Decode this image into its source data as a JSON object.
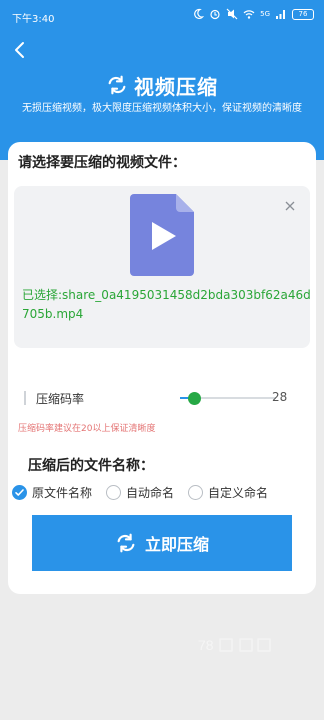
{
  "status_bar": {
    "time": "下午3:40",
    "battery": "76",
    "signal": "5G"
  },
  "header": {
    "title": "视频压缩",
    "subtitle": "无损压缩视频，极大限度压缩视频体积大小，保证视频的清晰度",
    "color": "#2a93e8"
  },
  "file_section": {
    "title": "请选择要压缩的视频文件：",
    "selected_prefix": "已选择:",
    "file_name": "share_0a4195031458d2bda303bf62a46d705b.mp4",
    "icon_color": "#7684dd"
  },
  "rate": {
    "label": "压缩码率",
    "value": "28",
    "level": 0.15,
    "hint": "压缩码率建议在20以上保证清晰度"
  },
  "name_section": {
    "title": "压缩后的文件名称：",
    "options": [
      {
        "label": "原文件名称",
        "selected": true
      },
      {
        "label": "自动命名",
        "selected": false
      },
      {
        "label": "自定义命名",
        "selected": false
      }
    ]
  },
  "action": {
    "button": "立即压缩"
  }
}
